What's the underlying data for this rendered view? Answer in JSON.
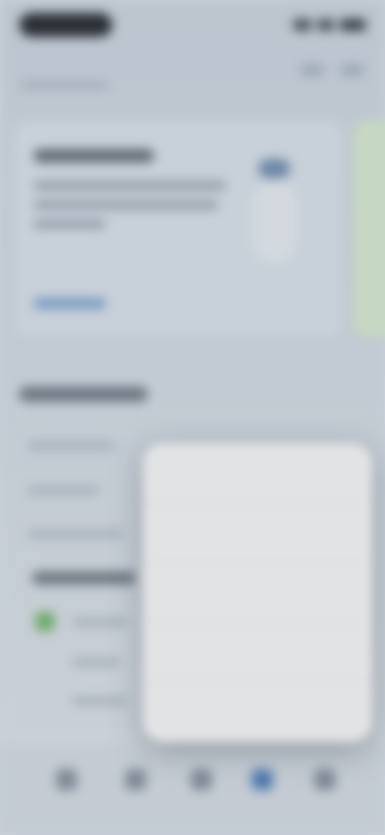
{
  "menu": {
    "items": [
      {
        "label": ""
      },
      {
        "label": ""
      },
      {
        "label": ""
      },
      {
        "label": ""
      },
      {
        "label": ""
      }
    ]
  },
  "tabs": [
    {
      "icon": "home-icon"
    },
    {
      "icon": "grid-icon"
    },
    {
      "icon": "shield-icon"
    },
    {
      "icon": "user-icon"
    },
    {
      "icon": "menu-icon"
    }
  ],
  "colors": {
    "accent": "#4f79ad",
    "success": "#6fa86c",
    "menu_background": "#e1e3e5"
  }
}
